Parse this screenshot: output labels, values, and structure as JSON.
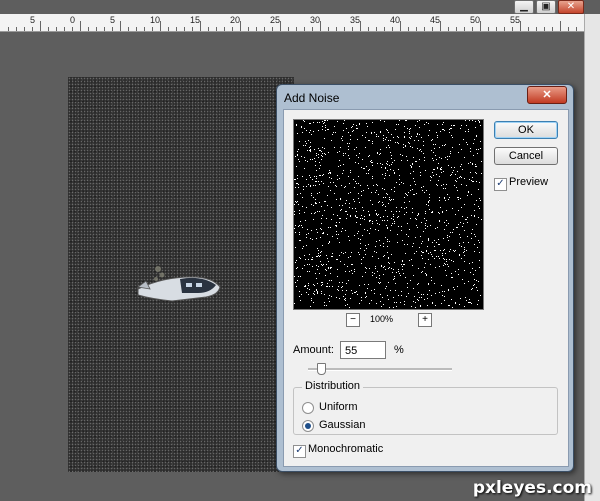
{
  "window": {
    "controls": [
      {
        "name": "minimize",
        "glyph": "▁"
      },
      {
        "name": "restore",
        "glyph": "▣"
      },
      {
        "name": "close",
        "glyph": "✕"
      }
    ]
  },
  "ruler": {
    "labels": [
      "5",
      "0",
      "5",
      "10",
      "15",
      "20",
      "25",
      "30",
      "35",
      "40",
      "45",
      "50",
      "55"
    ]
  },
  "dialog": {
    "title": "Add Noise",
    "close_glyph": "✕",
    "ok_label": "OK",
    "cancel_label": "Cancel",
    "preview_label": "Preview",
    "preview_checked": true,
    "zoom_out_glyph": "−",
    "zoom_in_glyph": "+",
    "zoom_level": "100%",
    "amount_label": "Amount:",
    "amount_value": "55",
    "amount_unit": "%",
    "amount_slider_fraction": 0.055,
    "distribution_label": "Distribution",
    "options": [
      {
        "label": "Uniform",
        "selected": false
      },
      {
        "label": "Gaussian",
        "selected": true
      }
    ],
    "monochromatic_label": "Monochromatic",
    "monochromatic_checked": true
  },
  "colors": {
    "workspace": "#5e5e5e",
    "dialog_frame": "#aebfd1",
    "accent": "#3c7fb1"
  },
  "watermark": "pxleyes.com"
}
